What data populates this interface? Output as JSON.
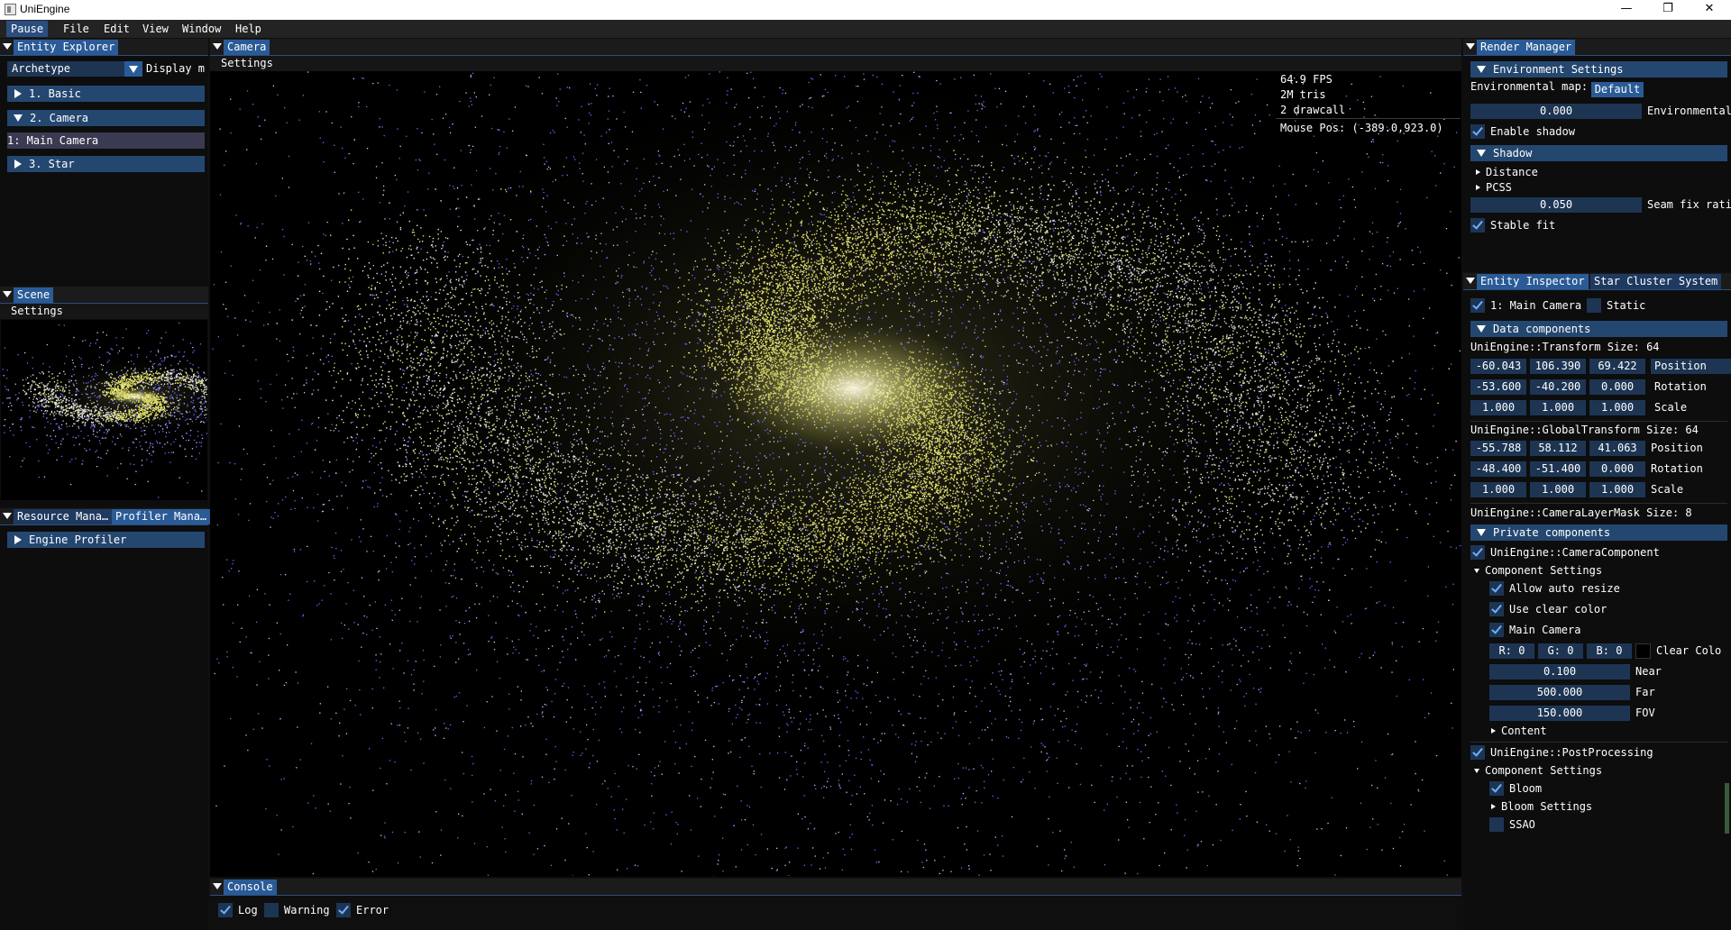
{
  "app": {
    "title": "UniEngine"
  },
  "window_controls": {
    "minimize": "—",
    "maximize": "❐",
    "close": "✕"
  },
  "menu": {
    "pause": "Pause",
    "items": [
      "File",
      "Edit",
      "View",
      "Window",
      "Help"
    ]
  },
  "entity_explorer": {
    "tab": "Entity Explorer",
    "archetype_value": "Archetype",
    "display_label": "Display m",
    "items": [
      {
        "label": "1. Basic",
        "expanded": false
      },
      {
        "label": "2. Camera",
        "expanded": true
      },
      {
        "label": "3. Star",
        "expanded": false
      }
    ],
    "selected_entity": "1: Main Camera"
  },
  "scene": {
    "tab": "Scene",
    "settings": "Settings"
  },
  "resource_profiler": {
    "tabs": [
      "Resource Mana…",
      "Profiler Mana…"
    ],
    "engine_profiler": "Engine Profiler"
  },
  "camera": {
    "tab": "Camera",
    "settings": "Settings",
    "stats": {
      "fps": "64.9 FPS",
      "tris": "2M tris",
      "drawcall": "2 drawcall",
      "mouse_pos": "Mouse Pos: (-389.0,923.0)"
    }
  },
  "console": {
    "tab": "Console",
    "filters": [
      {
        "label": "Log",
        "checked": true
      },
      {
        "label": "Warning",
        "checked": false
      },
      {
        "label": "Error",
        "checked": true
      }
    ]
  },
  "render_manager": {
    "tab": "Render Manager",
    "env_settings": "Environment Settings",
    "env_map_label": "Environmental map:",
    "env_map_value": "Default",
    "env_intensity_value": "0.000",
    "env_intensity_label": "Environmental",
    "enable_shadow": "Enable shadow",
    "shadow": "Shadow",
    "distance": "Distance",
    "pcss": "PCSS",
    "seam_fix_value": "0.050",
    "seam_fix_label": "Seam fix rati",
    "stable_fit": "Stable fit"
  },
  "inspector": {
    "tabs": [
      "Entity Inspector",
      "Star Cluster System"
    ],
    "entity_name": "1: Main Camera",
    "static_label": "Static",
    "data_components": "Data components",
    "transform": {
      "header": "UniEngine::Transform Size: 64",
      "rows": [
        {
          "values": [
            "-60.043",
            "106.390",
            "69.422"
          ],
          "label": "Position"
        },
        {
          "values": [
            "-53.600",
            "-40.200",
            "0.000"
          ],
          "label": "Rotation"
        },
        {
          "values": [
            "1.000",
            "1.000",
            "1.000"
          ],
          "label": "Scale"
        }
      ]
    },
    "global_transform": {
      "header": "UniEngine::GlobalTransform Size: 64",
      "rows": [
        {
          "values": [
            "-55.788",
            "58.112",
            "41.063"
          ],
          "label": "Position"
        },
        {
          "values": [
            "-48.400",
            "-51.400",
            "0.000"
          ],
          "label": "Rotation"
        },
        {
          "values": [
            "1.000",
            "1.000",
            "1.000"
          ],
          "label": "Scale"
        }
      ]
    },
    "camera_layer_mask": "UniEngine::CameraLayerMask Size: 8",
    "private_components": "Private components",
    "camera_component": "UniEngine::CameraComponent",
    "component_settings": "Component Settings",
    "allow_auto_resize": "Allow auto resize",
    "use_clear_color": "Use clear color",
    "main_camera": "Main Camera",
    "rgb": [
      "R:  0",
      "G:  0",
      "B:  0"
    ],
    "clear_color_label": "Clear Colo",
    "near_value": "0.100",
    "near_label": "Near",
    "far_value": "500.000",
    "far_label": "Far",
    "fov_value": "150.000",
    "fov_label": "FOV",
    "content": "Content",
    "post_processing": "UniEngine::PostProcessing",
    "component_settings_2": "Component Settings",
    "bloom": "Bloom",
    "bloom_settings": "Bloom Settings",
    "ssao": "SSAO"
  },
  "colors": {
    "accent": "#2a5b97",
    "header": "#244770",
    "field": "#1d3553",
    "check": "#6cb0ff"
  }
}
